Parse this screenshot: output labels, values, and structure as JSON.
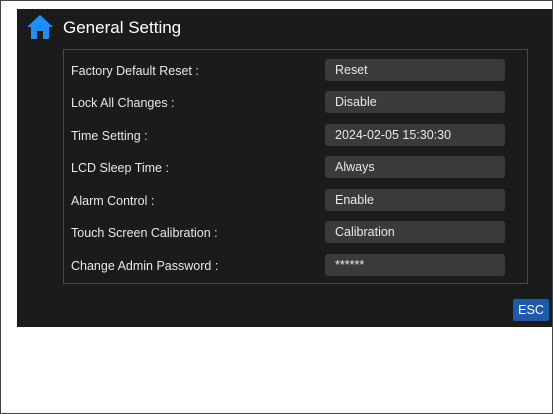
{
  "header": {
    "title": "General Setting",
    "home_icon": "home-icon"
  },
  "settings": [
    {
      "label": "Factory Default Reset :",
      "value": "Reset"
    },
    {
      "label": "Lock All Changes :",
      "value": "Disable"
    },
    {
      "label": "Time Setting :",
      "value": "2024-02-05  15:30:30"
    },
    {
      "label": "LCD Sleep Time :",
      "value": "Always"
    },
    {
      "label": "Alarm Control :",
      "value": "Enable"
    },
    {
      "label": "Touch Screen Calibration :",
      "value": "Calibration"
    },
    {
      "label": "Change Admin Password :",
      "value": "******"
    }
  ],
  "footer": {
    "esc_label": "ESC"
  },
  "colors": {
    "background": "#1b1b1b",
    "field": "#3a3a3a",
    "accent": "#1e5aa8",
    "home_icon": "#1f8fff"
  }
}
